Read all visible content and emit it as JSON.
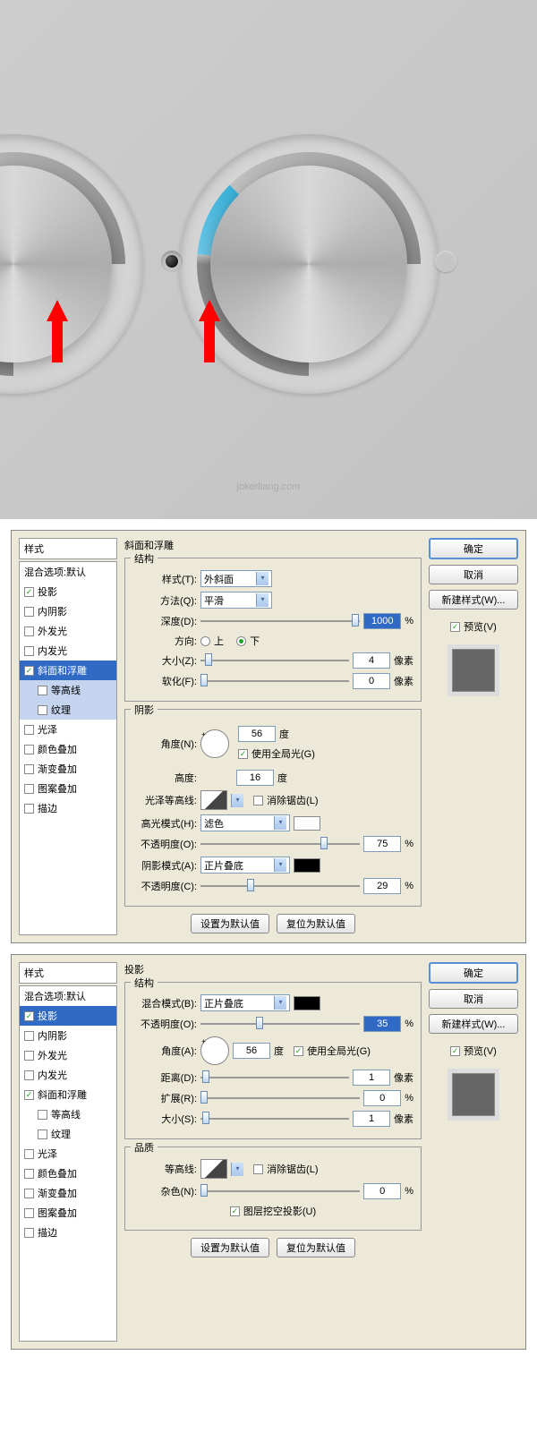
{
  "watermark": "jokerliang.com",
  "sidebar": {
    "header": "样式",
    "blend": "混合选项:默认",
    "items": [
      "投影",
      "内阴影",
      "外发光",
      "内发光",
      "斜面和浮雕",
      "等高线",
      "纹理",
      "光泽",
      "颜色叠加",
      "渐变叠加",
      "图案叠加",
      "描边"
    ]
  },
  "buttons": {
    "ok": "确定",
    "cancel": "取消",
    "newstyle": "新建样式(W)...",
    "preview": "预览(V)",
    "defaults": "设置为默认值",
    "reset": "复位为默认值"
  },
  "panel1": {
    "title": "斜面和浮雕",
    "struct": {
      "title": "结构",
      "style_l": "样式(T):",
      "style_v": "外斜面",
      "tech_l": "方法(Q):",
      "tech_v": "平滑",
      "depth_l": "深度(D):",
      "depth_v": "1000",
      "dir_l": "方向:",
      "up": "上",
      "down": "下",
      "size_l": "大小(Z):",
      "size_v": "4",
      "soft_l": "软化(F):",
      "soft_v": "0"
    },
    "shade": {
      "title": "阴影",
      "angle_l": "角度(N):",
      "angle_v": "56",
      "global": "使用全局光(G)",
      "alt_l": "高度:",
      "alt_v": "16",
      "gloss_l": "光泽等高线:",
      "anti": "消除锯齿(L)",
      "hlmode_l": "高光模式(H):",
      "hlmode_v": "滤色",
      "hlop_l": "不透明度(O):",
      "hlop_v": "75",
      "shmode_l": "阴影模式(A):",
      "shmode_v": "正片叠底",
      "shop_l": "不透明度(C):",
      "shop_v": "29"
    },
    "unit_pct": "%",
    "unit_px": "像素",
    "unit_deg": "度"
  },
  "panel2": {
    "title": "投影",
    "struct": {
      "title": "结构",
      "mode_l": "混合模式(B):",
      "mode_v": "正片叠底",
      "op_l": "不透明度(O):",
      "op_v": "35",
      "angle_l": "角度(A):",
      "angle_v": "56",
      "global": "使用全局光(G)",
      "dist_l": "距离(D):",
      "dist_v": "1",
      "spread_l": "扩展(R):",
      "spread_v": "0",
      "size_l": "大小(S):",
      "size_v": "1"
    },
    "qual": {
      "title": "品质",
      "contour_l": "等高线:",
      "anti": "消除锯齿(L)",
      "noise_l": "杂色(N):",
      "noise_v": "0",
      "knockout": "图层挖空投影(U)"
    },
    "unit_pct": "%",
    "unit_px": "像素",
    "unit_deg": "度"
  }
}
